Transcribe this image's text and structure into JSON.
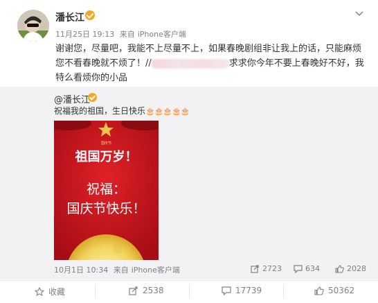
{
  "post": {
    "username": "潘长江",
    "date": "11月25日 19:13",
    "source_prefix": "来自",
    "source": "iPhone客户端",
    "text_part1": "谢谢您，尽量吧，我能不上尽量不上，如果春晚剧组非让我上的话，只能麻烦您不看春晚就不烦了！//",
    "text_part2": "求求你今年不要上春晚好不好，我特么看烦你的小品"
  },
  "repost": {
    "username": "@潘长江",
    "text": "祝福我的祖国，生日快乐",
    "cake_icons": "🎂🎂🎂🎂🎂",
    "poster": {
      "small_label": "国庆节",
      "line1": "祖国万岁！",
      "line2": "祝福：",
      "line3": "国庆节快乐！"
    },
    "date": "10月1日 10:34",
    "source_prefix": "来自",
    "source": "iPhone客户端",
    "forward_count": "2723",
    "comment_count": "634",
    "like_count": "2028"
  },
  "actions": {
    "favorite_label": "收藏",
    "forward_count": "2538",
    "comment_count": "17739",
    "like_count": "50362"
  },
  "colors": {
    "verified_badge": "#f5a623",
    "poster_red": "#c3151d",
    "muted_text": "#808080",
    "repost_bg": "#f2f2f5"
  }
}
